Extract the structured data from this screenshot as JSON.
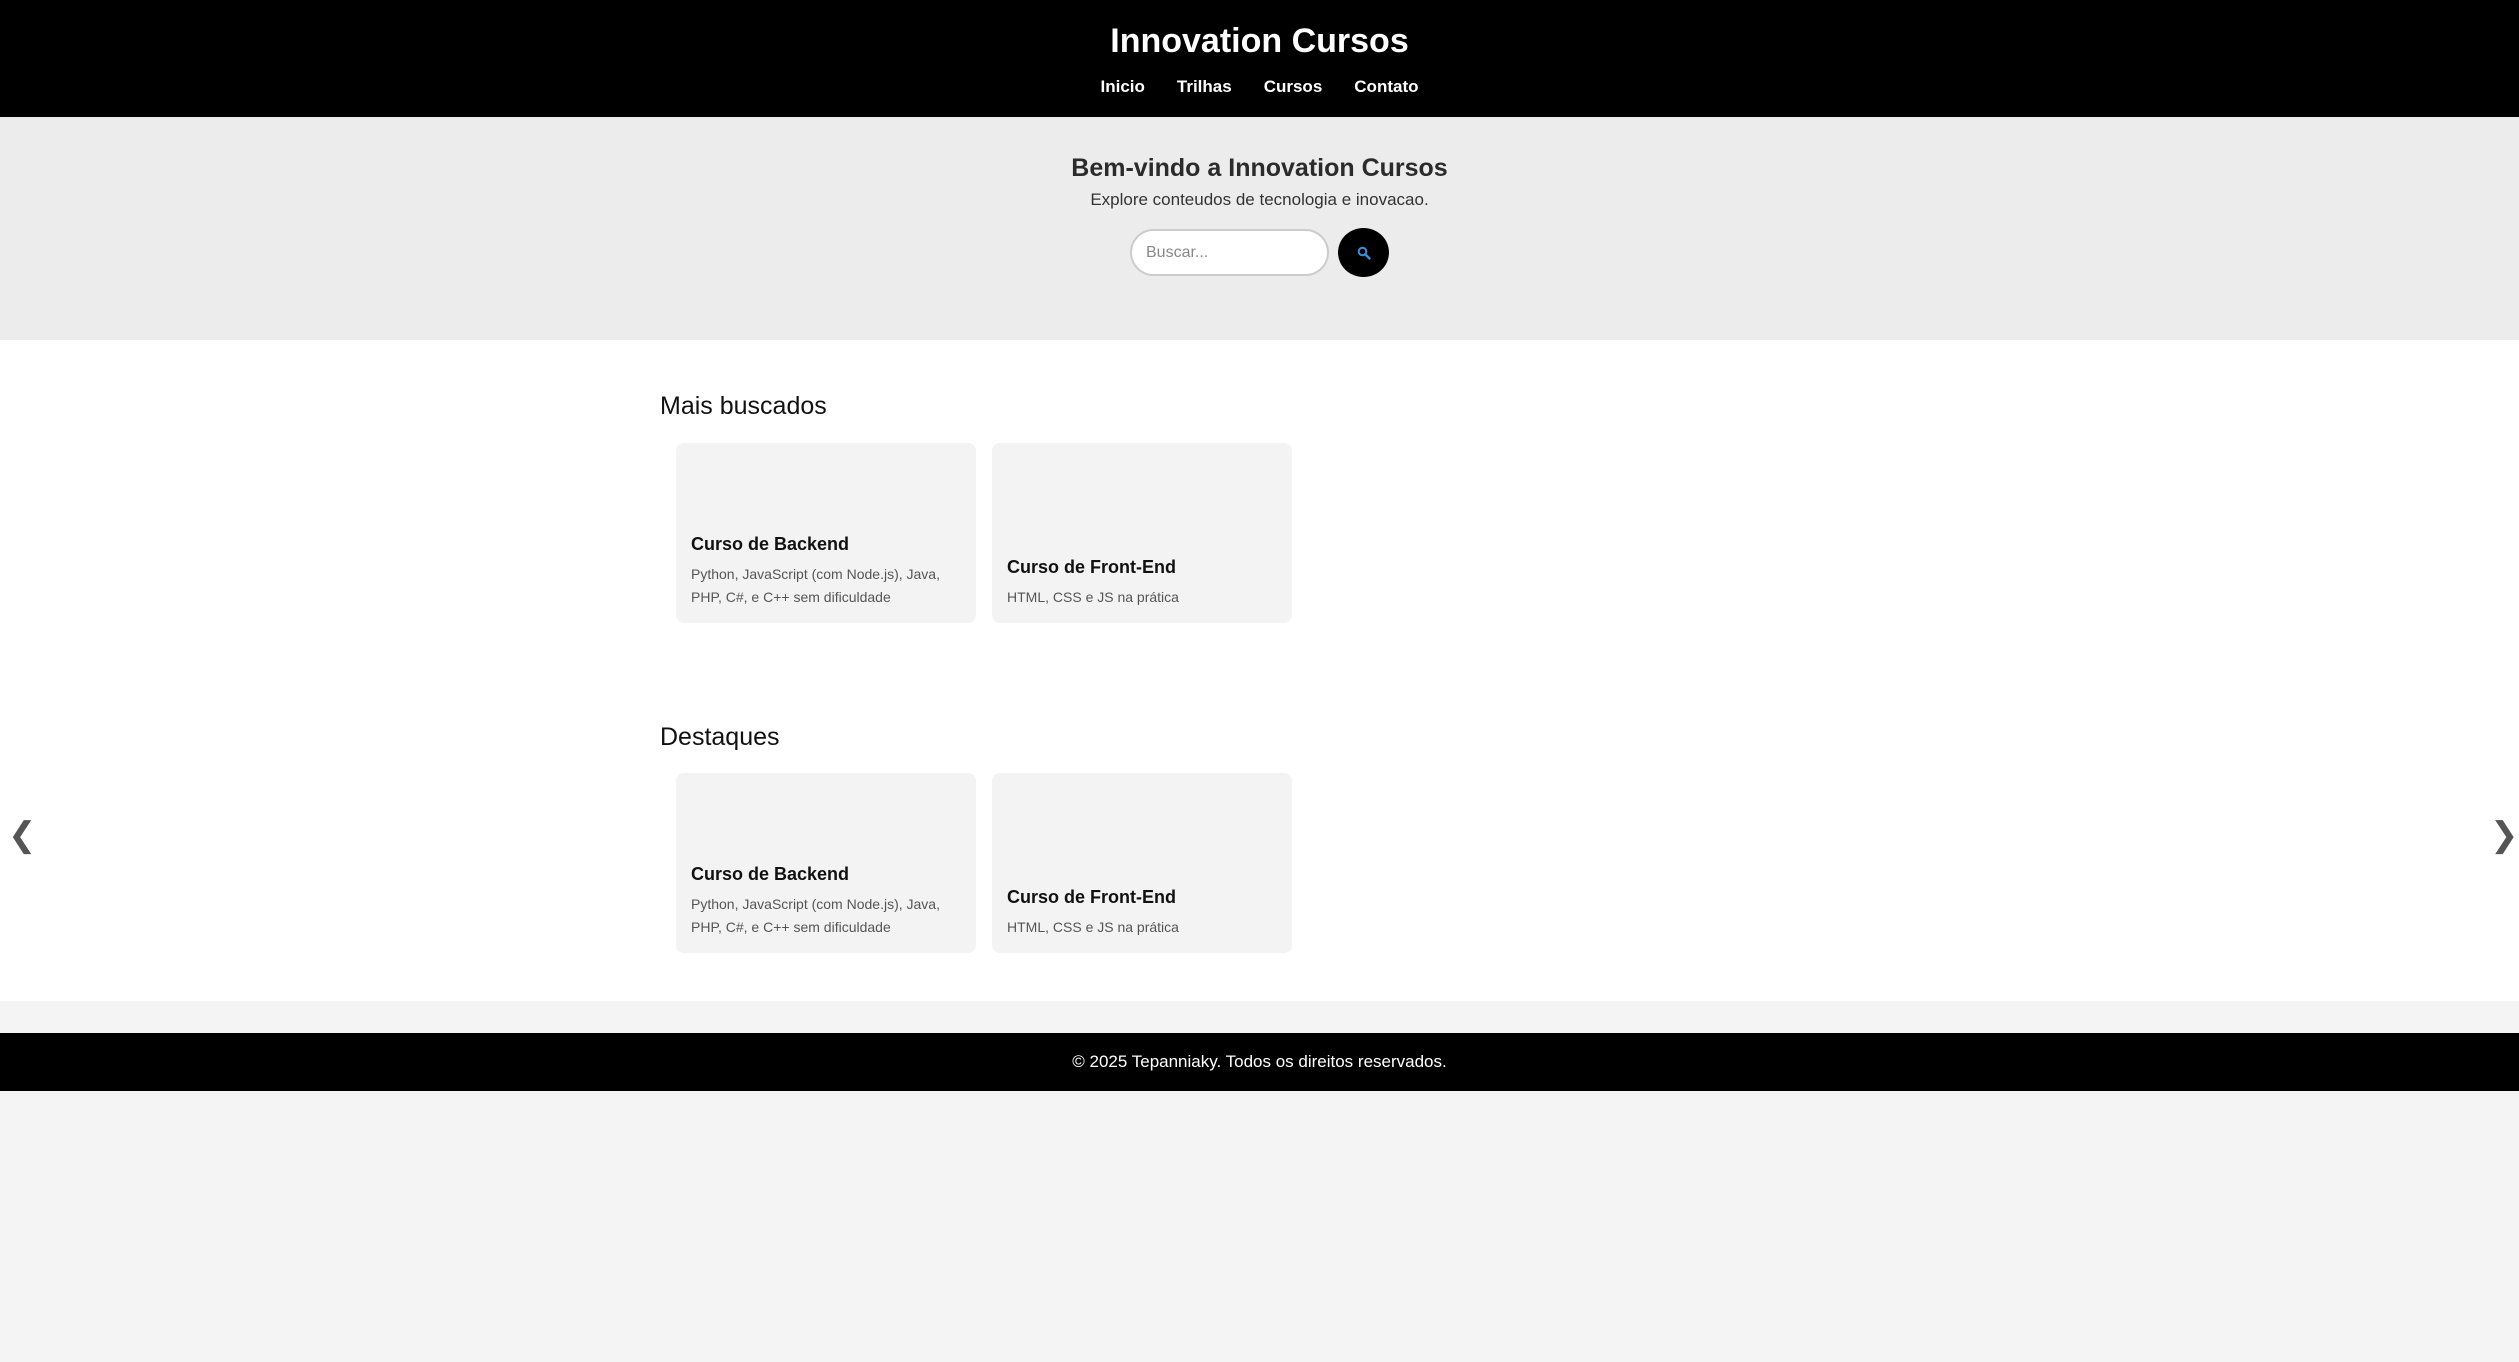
{
  "header": {
    "title": "Innovation Cursos",
    "nav": [
      {
        "label": "Inicio"
      },
      {
        "label": "Trilhas"
      },
      {
        "label": "Cursos"
      },
      {
        "label": "Contato"
      }
    ]
  },
  "hero": {
    "title": "Bem-vindo a Innovation Cursos",
    "subtitle": "Explore conteudos de tecnologia e inovacao.",
    "search": {
      "placeholder": "Buscar...",
      "value": "",
      "button_icon": "search-icon"
    }
  },
  "sections": [
    {
      "title": "Mais buscados",
      "cards": [
        {
          "title": "Curso de Backend",
          "description": "Python, JavaScript (com Node.js), Java, PHP, C#, e C++ sem dificuldade"
        },
        {
          "title": "Curso de Front-End",
          "description": "HTML, CSS e JS na prática"
        }
      ]
    },
    {
      "title": "Destaques",
      "cards": [
        {
          "title": "Curso de Backend",
          "description": "Python, JavaScript (com Node.js), Java, PHP, C#, e C++ sem dificuldade"
        },
        {
          "title": "Curso de Front-End",
          "description": "HTML, CSS e JS na prática"
        }
      ]
    }
  ],
  "carousel": {
    "prev_glyph": "❮",
    "next_glyph": "❯"
  },
  "footer": {
    "text": "© 2025 Tepanniaky. Todos os direitos reservados."
  },
  "colors": {
    "header_bg": "#000000",
    "hero_bg": "#ececec",
    "content_bg": "#ffffff",
    "card_bg": "#f3f3f3",
    "page_bg": "#f4f4f4",
    "search_icon": "#3a8fd8"
  }
}
